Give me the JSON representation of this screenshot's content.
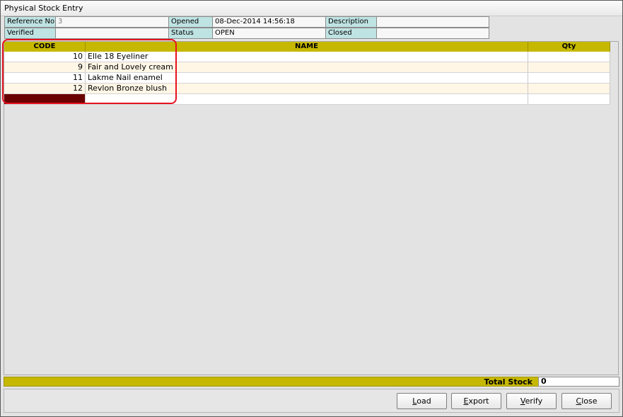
{
  "window": {
    "title": "Physical Stock Entry"
  },
  "info": {
    "reference_label": "Reference No",
    "reference_value": "3",
    "opened_label": "Opened",
    "opened_value": "08-Dec-2014 14:56:18",
    "description_label": "Description",
    "description_value": "",
    "verified_label": "Verified",
    "verified_value": "",
    "status_label": "Status",
    "status_value": "OPEN",
    "closed_label": "Closed",
    "closed_value": ""
  },
  "table": {
    "columns": [
      "CODE",
      "NAME",
      "Qty"
    ],
    "rows": [
      {
        "code": "10",
        "name": "Elle 18 Eyeliner",
        "qty": ""
      },
      {
        "code": "9",
        "name": "Fair and Lovely cream",
        "qty": ""
      },
      {
        "code": "11",
        "name": "Lakme Nail enamel",
        "qty": ""
      },
      {
        "code": "12",
        "name": "Revlon Bronze blush",
        "qty": ""
      },
      {
        "code": "",
        "name": "",
        "qty": ""
      }
    ]
  },
  "footer": {
    "total_label": "Total Stock",
    "total_value": "0",
    "buttons": [
      {
        "mnemonic": "L",
        "rest": "oad"
      },
      {
        "mnemonic": "E",
        "rest": "xport"
      },
      {
        "mnemonic": "V",
        "rest": "erify"
      },
      {
        "mnemonic": "C",
        "rest": "lose"
      }
    ]
  },
  "colors": {
    "header_bar": "#c6b800",
    "label_cell": "#bfe3e3",
    "selected_cell": "#6a0000",
    "highlight": "#e8121f"
  }
}
